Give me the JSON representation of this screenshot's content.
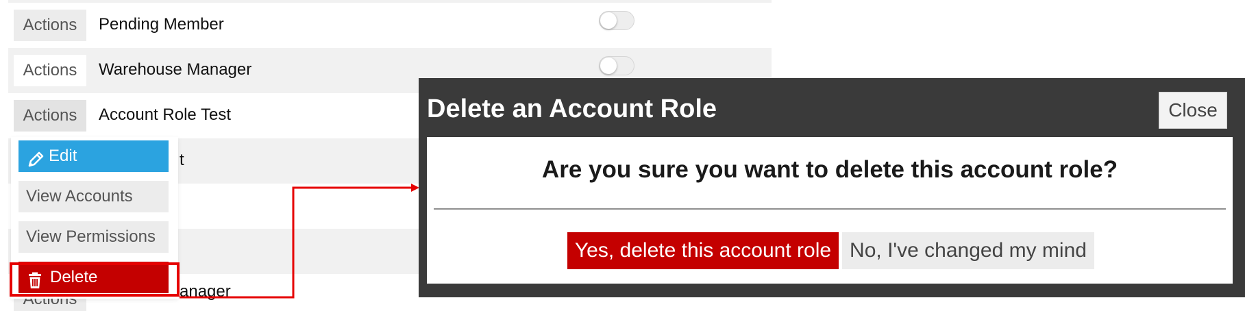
{
  "table": {
    "actions_label": "Actions",
    "rows": [
      {
        "name": "Pending Member",
        "toggle_on": false
      },
      {
        "name": "Warehouse Manager",
        "toggle_on": false
      },
      {
        "name": "Account Role Test"
      },
      {
        "name_fragment": "t"
      },
      {
        "name_fragment": "anager"
      }
    ]
  },
  "dropdown": {
    "items": [
      {
        "label": "Edit",
        "icon": "pencil-icon",
        "color": "#2ba3e0"
      },
      {
        "label": "View Accounts"
      },
      {
        "label": "View Permissions"
      },
      {
        "label": "Delete",
        "icon": "trash-icon",
        "color": "#c40000"
      }
    ]
  },
  "modal": {
    "title": "Delete an Account Role",
    "close_label": "Close",
    "question": "Are you sure you want to delete this account role?",
    "confirm_label": "Yes, delete this account role",
    "cancel_label": "No, I've changed my mind"
  },
  "colors": {
    "danger": "#c40000",
    "primary": "#2ba3e0",
    "modal_frame": "#3a3a3a",
    "annotation": "#e60000"
  }
}
